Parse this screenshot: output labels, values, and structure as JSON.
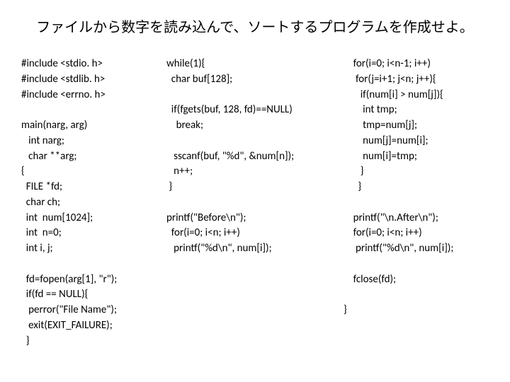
{
  "title": "ファイルから数字を読み込んで、ソートするプログラムを作成せよ。",
  "code": {
    "col1": "#include <stdio. h>\n#include <stdlib. h>\n#include <errno. h>\n\nmain(narg, arg)\n   int narg;\n   char **arg;\n{\n  FILE *fd;\n  char ch;\n  int  num[1024];\n  int  n=0;\n  int i, j;\n\n  fd=fopen(arg[1], \"r\");\n  if(fd == NULL){\n   perror(\"File Name\");\n   exit(EXIT_FAILURE);\n  }",
    "col2": "while(1){\n  char buf[128];\n\n  if(fgets(buf, 128, fd)==NULL)\n    break;\n\n   sscanf(buf, \"%d\", &num[n]);\n   n++;\n }\n\nprintf(\"Before\\n\");\n  for(i=0; i<n; i++)\n   printf(\"%d\\n\", num[i]);",
    "col3": "    for(i=0; i<n-1; i++)\n     for(j=i+1; j<n; j++){\n       if(num[i] > num[j]){\n        int tmp;\n        tmp=num[j];\n        num[j]=num[i];\n        num[i]=tmp;\n       }\n      }\n\n    printf(\"\\n.After\\n\");\n    for(i=0; i<n; i++)\n     printf(\"%d\\n\", num[i]);\n\n    fclose(fd);\n\n}"
  }
}
